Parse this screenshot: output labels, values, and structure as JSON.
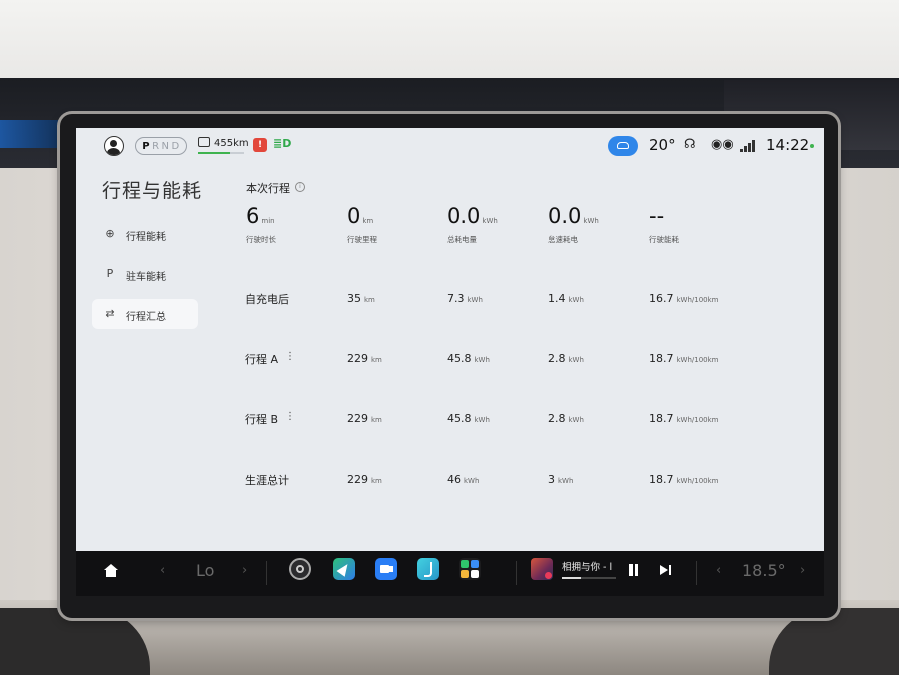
{
  "status_bar": {
    "gears": [
      "P",
      "R",
      "N",
      "D"
    ],
    "selected_gear": "P",
    "range": "455km",
    "range_level": 0.7,
    "temperature": "20°",
    "time": "14:22",
    "signal_label": "5G"
  },
  "sidebar": {
    "title": "行程与能耗",
    "items": [
      {
        "icon": "steering-wheel-icon",
        "glyph": "⊕",
        "label": "行程能耗",
        "active": false
      },
      {
        "icon": "parking-icon",
        "glyph": "P",
        "label": "驻车能耗",
        "active": false
      },
      {
        "icon": "swap-arrows-icon",
        "glyph": "⇄",
        "label": "行程汇总",
        "active": true
      }
    ]
  },
  "current_trip": {
    "title": "本次行程",
    "info_glyph": "i",
    "stats": [
      {
        "value": "6",
        "unit": "min",
        "label": "行驶时长"
      },
      {
        "value": "0",
        "unit": "km",
        "label": "行驶里程"
      },
      {
        "value": "0.0",
        "unit": "kWh",
        "label": "总耗电量"
      },
      {
        "value": "0.0",
        "unit": "kWh",
        "label": "怠速耗电"
      },
      {
        "value": "--",
        "unit": "",
        "label": "行驶能耗"
      }
    ]
  },
  "summary_rows": [
    {
      "label": "自充电后",
      "menu": "",
      "distance": "35",
      "distance_unit": "km",
      "energy": "7.3",
      "energy_unit": "kWh",
      "idle": "1.4",
      "idle_unit": "kWh",
      "consumption": "16.7",
      "consumption_unit": "kWh/100km"
    },
    {
      "label": "行程 A",
      "menu": "⋮",
      "distance": "229",
      "distance_unit": "km",
      "energy": "45.8",
      "energy_unit": "kWh",
      "idle": "2.8",
      "idle_unit": "kWh",
      "consumption": "18.7",
      "consumption_unit": "kWh/100km"
    },
    {
      "label": "行程 B",
      "menu": "⋮",
      "distance": "229",
      "distance_unit": "km",
      "energy": "45.8",
      "energy_unit": "kWh",
      "idle": "2.8",
      "idle_unit": "kWh",
      "consumption": "18.7",
      "consumption_unit": "kWh/100km"
    },
    {
      "label": "生涯总计",
      "menu": "",
      "distance": "229",
      "distance_unit": "km",
      "energy": "46",
      "energy_unit": "kWh",
      "idle": "3",
      "idle_unit": "kWh",
      "consumption": "18.7",
      "consumption_unit": "kWh/100km"
    }
  ],
  "dock": {
    "left_text": "Lo",
    "chev_left": "‹",
    "chev_right": "›",
    "apps": [
      "steering-wheel-app",
      "navigation-app",
      "video-call-app",
      "seat-app",
      "apps-grid"
    ],
    "song_title": "相拥与你 - l",
    "song_progress": 0.35,
    "right_temp": "18.5°"
  },
  "colors": {
    "accent_blue": "#2f86e9",
    "range_green": "#3fb34f",
    "alert_red": "#e2473b",
    "screen_bg": "#e8ebef"
  }
}
